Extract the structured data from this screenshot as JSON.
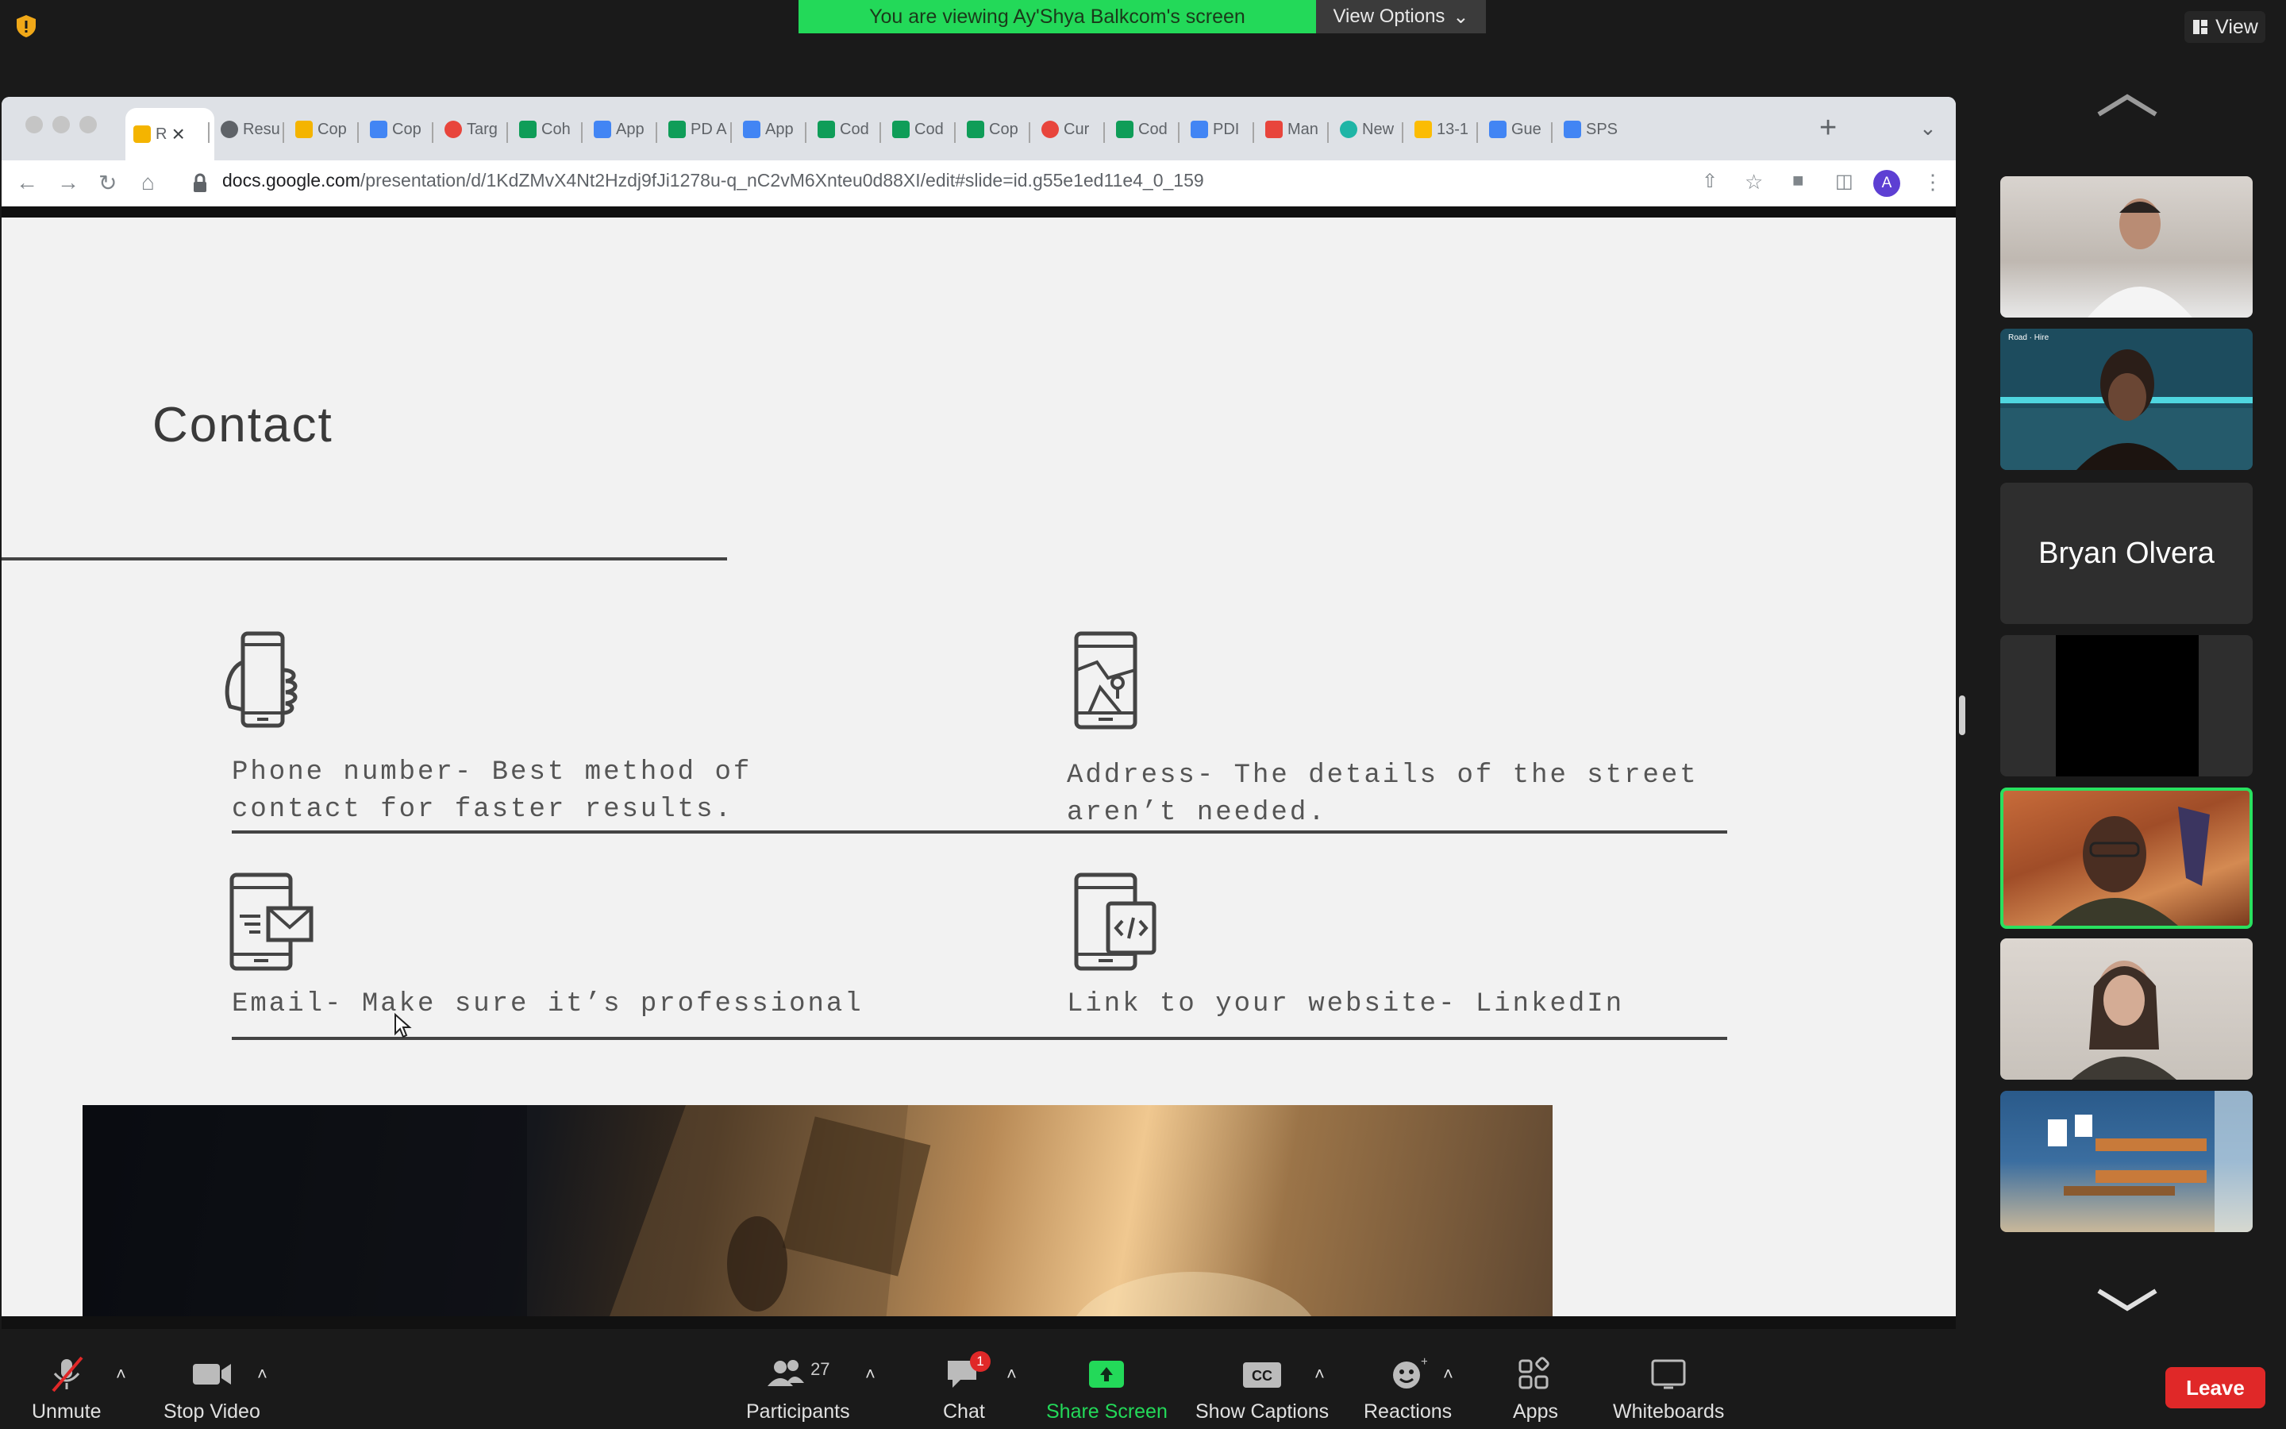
{
  "zoom": {
    "banner_text": "You are viewing Ay'Shya Balkcom's screen",
    "view_options_label": "View Options",
    "view_label": "View",
    "participant_count": "27",
    "chat_badge": "1",
    "toolbar": {
      "unmute": "Unmute",
      "stop_video": "Stop Video",
      "participants": "Participants",
      "chat": "Chat",
      "share_screen": "Share Screen",
      "show_captions": "Show Captions",
      "reactions": "Reactions",
      "apps": "Apps",
      "whiteboards": "Whiteboards",
      "leave": "Leave"
    },
    "gallery": {
      "name_tile": "Bryan Olvera",
      "small_label": "Road · Hire"
    },
    "colors": {
      "banner_green": "#23d959",
      "leave_red": "#e02828",
      "active_speaker": "#29e05f"
    }
  },
  "browser": {
    "tabs": [
      {
        "label": "R",
        "icon": "slides-icon",
        "active": true
      },
      {
        "label": "Resu",
        "icon": "globe-icon"
      },
      {
        "label": "Cop",
        "icon": "slides-icon"
      },
      {
        "label": "Cop",
        "icon": "docs-icon"
      },
      {
        "label": "Targ",
        "icon": "target-icon"
      },
      {
        "label": "Coh",
        "icon": "sheets-icon"
      },
      {
        "label": "App",
        "icon": "docs-icon"
      },
      {
        "label": "PD A",
        "icon": "sheets-icon"
      },
      {
        "label": "App",
        "icon": "docs-icon"
      },
      {
        "label": "Cod",
        "icon": "sheets-icon"
      },
      {
        "label": "Cod",
        "icon": "sheets-icon"
      },
      {
        "label": "Cop",
        "icon": "sheets-icon"
      },
      {
        "label": "Cur",
        "icon": "target-icon"
      },
      {
        "label": "Cod",
        "icon": "sheets-icon"
      },
      {
        "label": "PDI",
        "icon": "docs-icon"
      },
      {
        "label": "Man",
        "icon": "star-icon"
      },
      {
        "label": "New",
        "icon": "m-icon"
      },
      {
        "label": "13-1",
        "icon": "drive-icon"
      },
      {
        "label": "Gue",
        "icon": "docs-icon"
      },
      {
        "label": "SPS",
        "icon": "docs-icon"
      }
    ],
    "url_host": "docs.google.com",
    "url_path": "/presentation/d/1KdZMvX4Nt2Hzdj9fJi1278u-q_nC2vM6Xnteu0d88XI/edit#slide=id.g55e1ed11e4_0_159",
    "profile_initial": "A"
  },
  "slide": {
    "title": "Contact",
    "items": {
      "phone": {
        "line1": "Phone number- Best method of",
        "line2": "contact for faster results."
      },
      "address": {
        "line1": "Address- The details of the street",
        "line2": "aren’t needed."
      },
      "email": {
        "line1": "Email- Make sure it’s professional"
      },
      "link": {
        "line1": "Link to your website- LinkedIn"
      }
    }
  }
}
